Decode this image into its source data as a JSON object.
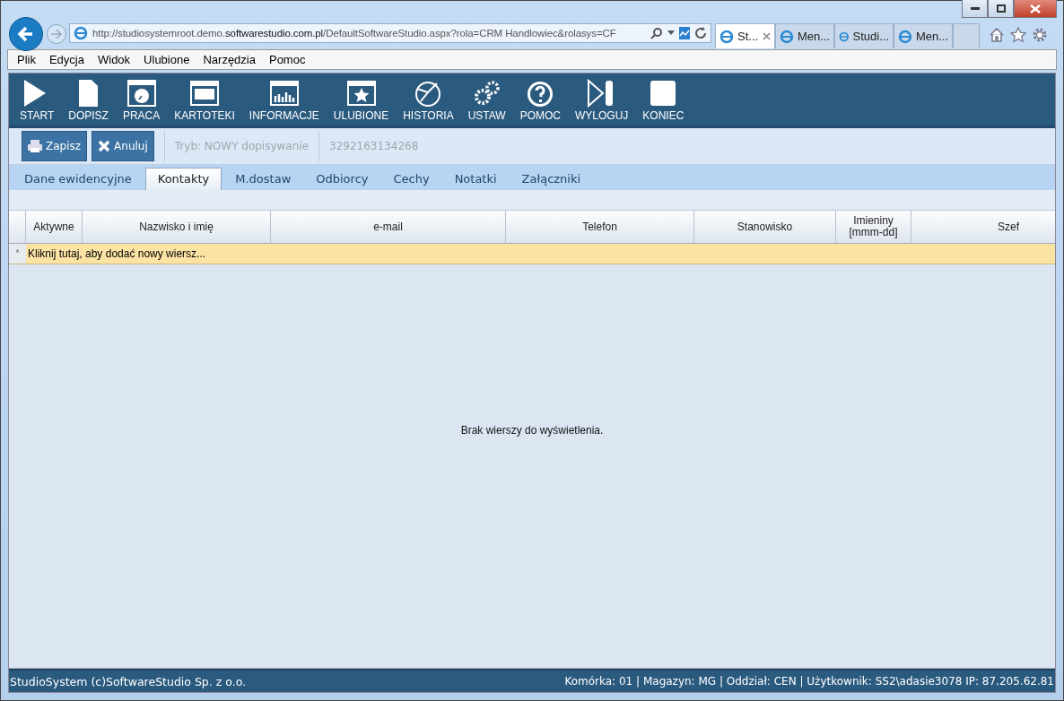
{
  "browser": {
    "address": {
      "prefix": "http://studiosystemroot.demo.",
      "domain": "softwarestudio.com.pl",
      "rest": "/DefaultSoftwareStudio.aspx?rola=CRM Handlowiec&rolasys=CF"
    },
    "tabs": [
      {
        "label": "St...",
        "selected": true
      },
      {
        "label": "Men...",
        "selected": false
      },
      {
        "label": "Studi...",
        "selected": false
      },
      {
        "label": "Men...",
        "selected": false
      }
    ],
    "menu": [
      "Plik",
      "Edycja",
      "Widok",
      "Ulubione",
      "Narzędzia",
      "Pomoc"
    ]
  },
  "toolbar": [
    "START",
    "DOPISZ",
    "PRACA",
    "KARTOTEKI",
    "INFORMACJE",
    "ULUBIONE",
    "HISTORIA",
    "USTAW",
    "POMOC",
    "WYLOGUJ",
    "KONIEC"
  ],
  "actions": {
    "buttons": [
      "Zapisz",
      "Anuluj"
    ],
    "mode": "Tryb: NOWY dopisywanie",
    "number": "3292163134268"
  },
  "tabs": [
    {
      "label": "Dane ewidencyjne",
      "selected": false
    },
    {
      "label": "Kontakty",
      "selected": true
    },
    {
      "label": "M.dostaw",
      "selected": false
    },
    {
      "label": "Odbiorcy",
      "selected": false
    },
    {
      "label": "Cechy",
      "selected": false
    },
    {
      "label": "Notatki",
      "selected": false
    },
    {
      "label": "Załączniki",
      "selected": false
    }
  ],
  "table": {
    "columns": [
      "Aktywne",
      "Nazwisko i imię",
      "e-mail",
      "Telefon",
      "Stanowisko",
      "Imieniny [mmm-dd]",
      "Szef"
    ],
    "new_row_marker": "*",
    "new_row": "Kliknij tutaj, aby dodać nowy wiersz...",
    "empty": "Brak wierszy do wyświetlenia."
  },
  "status_bar": {
    "left": "StudioSystem (c)SoftwareStudio Sp. z o.o.",
    "right": "Komórka: 01 | Magazyn: MG | Oddział: CEN | Użytkownik: SS2\\adasie3078 IP: 87.205.62.81"
  }
}
